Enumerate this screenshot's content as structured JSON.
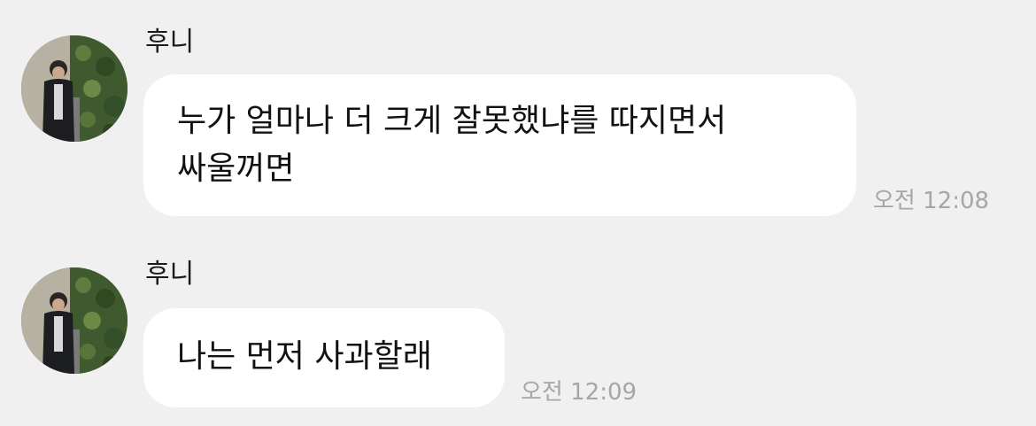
{
  "messages": [
    {
      "sender": "후니",
      "text_lines": [
        "누가 얼마나 더 크게 잘못했냐를 따지면서",
        "싸울꺼면"
      ],
      "time": "오전 12:08",
      "avatar_icon": "profile-photo-man-ivy-wall"
    },
    {
      "sender": "후니",
      "text_lines": [
        "나는 먼저 사과할래"
      ],
      "time": "오전 12:09",
      "avatar_icon": "profile-photo-man-ivy-wall"
    }
  ],
  "colors": {
    "background": "#f0f0f0",
    "bubble": "#ffffff",
    "timestamp": "#a6a6a6",
    "text": "#111111"
  }
}
